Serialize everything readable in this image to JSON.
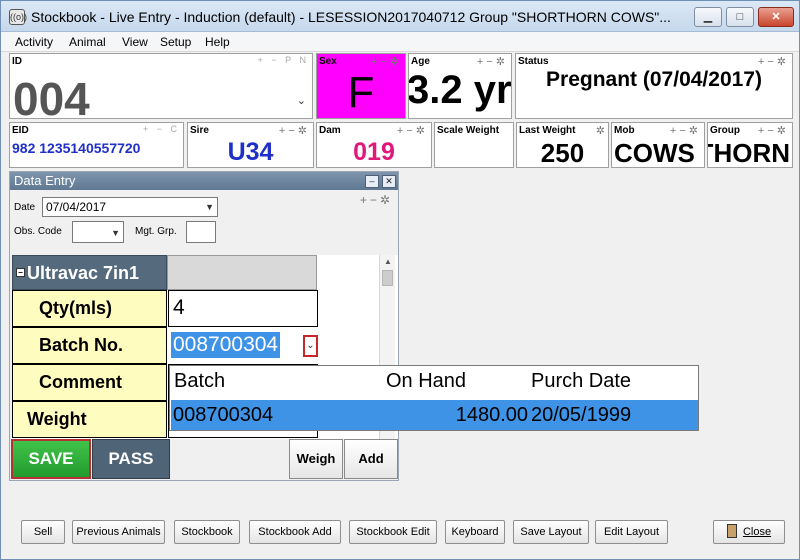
{
  "window": {
    "title": "Stockbook - Live Entry - Induction (default) - LESESSION2017040712 Group \"SHORTHORN COWS\"...",
    "app_icon": "((o))"
  },
  "menu": [
    "Activity",
    "Animal",
    "View",
    "Setup",
    "Help"
  ],
  "panels": {
    "id": {
      "label": "ID",
      "value": "004",
      "ctrl": "+ − P N"
    },
    "sex": {
      "label": "Sex",
      "value": "F"
    },
    "age": {
      "label": "Age",
      "value": "3.2 yr"
    },
    "status": {
      "label": "Status",
      "value": "Pregnant (07/04/2017)"
    },
    "eid": {
      "label": "EID",
      "value": "982 1235140557720",
      "ctrl": "+ − C"
    },
    "sire": {
      "label": "Sire",
      "value": "U34"
    },
    "dam": {
      "label": "Dam",
      "value": "019"
    },
    "scale_weight": {
      "label": "Scale Weight",
      "value": ""
    },
    "last_weight": {
      "label": "Last Weight",
      "value": "250"
    },
    "mob": {
      "label": "Mob",
      "value": "COWS"
    },
    "group": {
      "label": "Group",
      "value": "SHORTHORN"
    }
  },
  "data_entry": {
    "title": "Data Entry",
    "date_label": "Date",
    "date_value": "07/04/2017",
    "obs_code_label": "Obs. Code",
    "mgt_grp_label": "Mgt. Grp.",
    "group_name": "Ultravac 7in1",
    "rows": [
      {
        "label": "Qty(mls)",
        "value": "4"
      },
      {
        "label": "Batch No.",
        "value": "008700304"
      },
      {
        "label": "Comment",
        "value": ""
      },
      {
        "label": "Weight",
        "value": ""
      }
    ],
    "buttons": {
      "save": "SAVE",
      "pass": "PASS",
      "weigh": "Weigh",
      "add": "Add"
    }
  },
  "batch_popup": {
    "headers": [
      "Batch",
      "On Hand",
      "Purch Date"
    ],
    "rows": [
      {
        "batch": "008700304",
        "on_hand": "1480.00",
        "purch_date": "20/05/1999"
      }
    ]
  },
  "bottom_bar": [
    "Sell",
    "Previous Animals",
    "Stockbook",
    "Stockbook Add",
    "Stockbook Edit",
    "Keyboard",
    "Save Layout",
    "Edit Layout"
  ],
  "close_label": "Close",
  "colors": {
    "sex_bg": "#ff00ff",
    "eid_blue": "#1f2fc8",
    "dam_pink": "#e0187a",
    "save_green": "#2fae3a",
    "selection_blue": "#3f93e6",
    "label_yellow": "#fffcc0"
  }
}
